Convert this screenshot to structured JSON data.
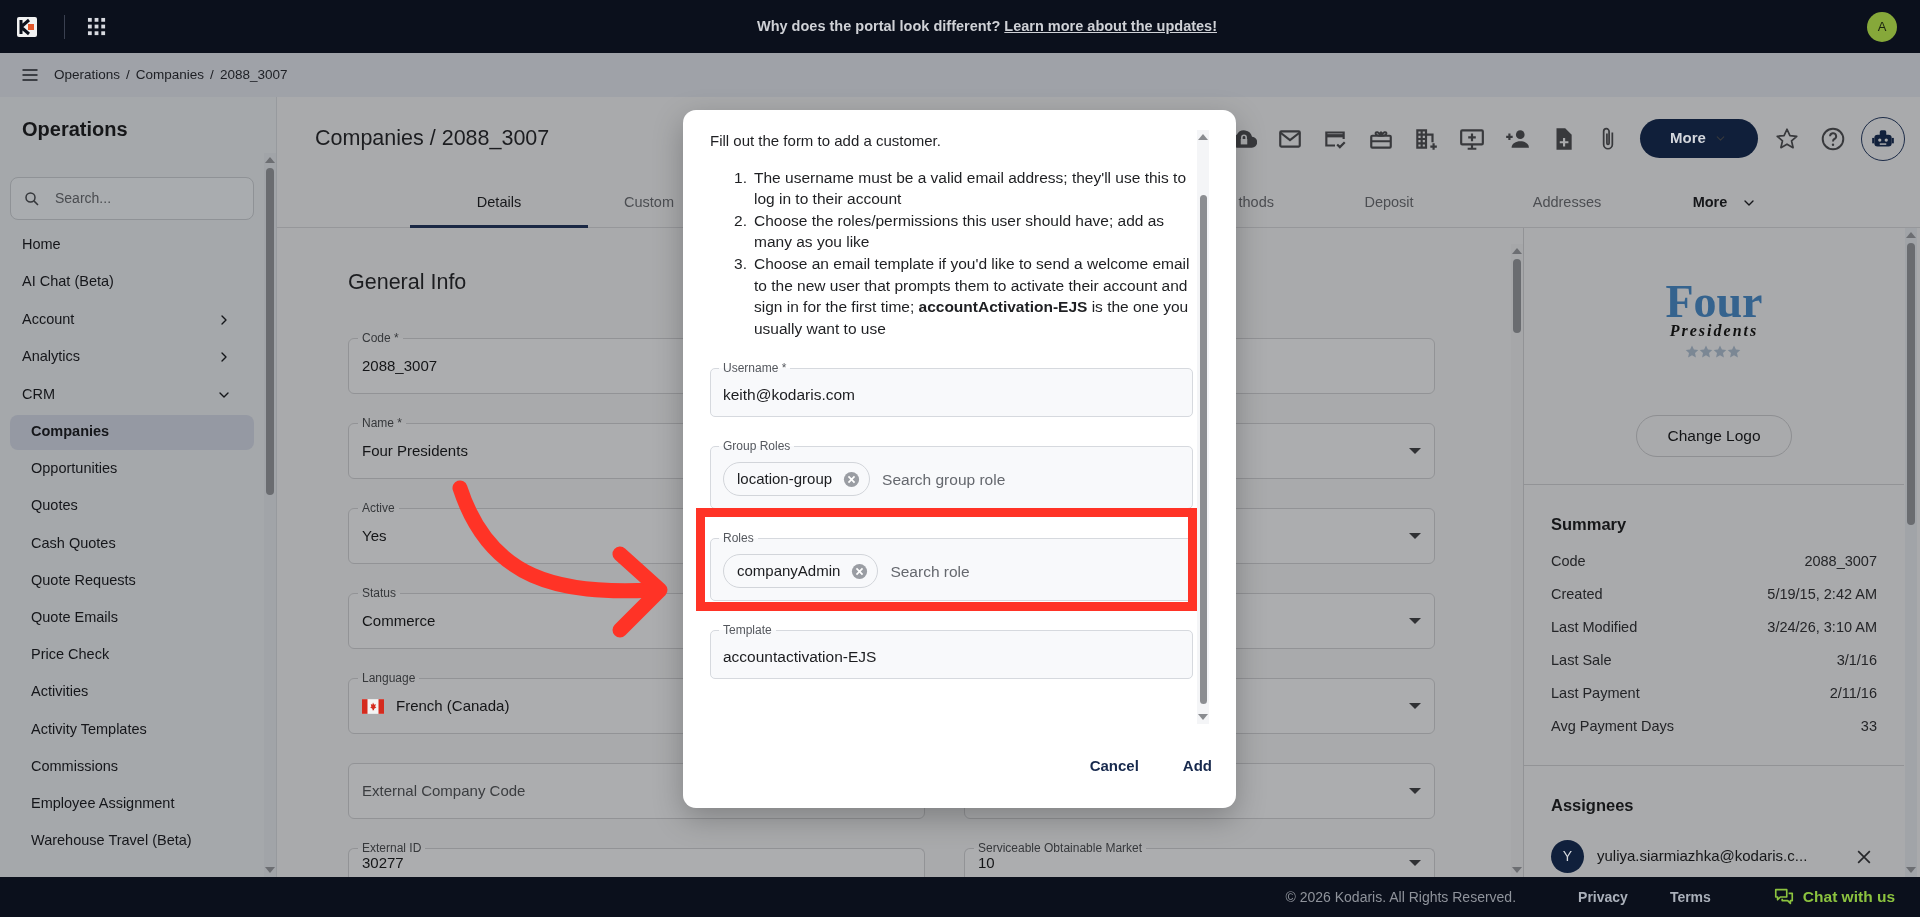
{
  "top_bar": {
    "announcement": "Why does the portal look different?",
    "link": "Learn more about the updates!",
    "avatar": "A"
  },
  "breadcrumb": {
    "separator": "/",
    "items": [
      "Operations",
      "Companies",
      "2088_3007"
    ]
  },
  "sidebar": {
    "title": "Operations",
    "search": {
      "placeholder": "Search..."
    },
    "items": [
      {
        "kind": "link",
        "label": "Home",
        "selected": false
      },
      {
        "kind": "link",
        "label": "AI Chat (Beta)",
        "selected": false
      },
      {
        "kind": "group",
        "label": "Account",
        "expanded": false,
        "selected": false
      },
      {
        "kind": "group",
        "label": "Analytics",
        "expanded": false,
        "selected": false
      },
      {
        "kind": "group",
        "label": "CRM",
        "expanded": true,
        "selected": false,
        "children": [
          {
            "label": "Companies",
            "selected": true
          },
          {
            "label": "Opportunities",
            "selected": false
          },
          {
            "label": "Quotes",
            "selected": false
          },
          {
            "label": "Cash Quotes",
            "selected": false
          },
          {
            "label": "Quote Requests",
            "selected": false
          },
          {
            "label": "Quote Emails",
            "selected": false
          },
          {
            "label": "Price Check",
            "selected": false
          },
          {
            "label": "Activities",
            "selected": false
          },
          {
            "label": "Activity Templates",
            "selected": false
          },
          {
            "label": "Commissions",
            "selected": false
          },
          {
            "label": "Employee Assignment",
            "selected": false
          },
          {
            "label": "Warehouse Travel (Beta)",
            "selected": false
          }
        ]
      }
    ]
  },
  "page": {
    "title": "Companies / 2088_3007",
    "more_button": "More",
    "tabs": [
      {
        "label": "Details",
        "selected": true
      },
      {
        "label": "Custom",
        "selected": false
      },
      {
        "label": "thods",
        "selected": false
      },
      {
        "label": "Deposit",
        "selected": false
      },
      {
        "label": "Addresses",
        "selected": false
      },
      {
        "label": "More",
        "selected": false,
        "kind": "menu"
      }
    ],
    "section_title": "General Info",
    "field_rows": [
      {
        "left": {
          "kind": "text",
          "label": "Code *",
          "value": "2088_3007"
        },
        "right": {
          "kind": "text"
        }
      },
      {
        "left": {
          "kind": "text",
          "label": "Name *",
          "value": "Four Presidents"
        },
        "right": {
          "kind": "select"
        }
      },
      {
        "left": {
          "kind": "text",
          "label": "Active",
          "value": "Yes"
        },
        "right": {
          "kind": "select"
        }
      },
      {
        "left": {
          "kind": "text",
          "label": "Status",
          "value": "Commerce"
        },
        "right": {
          "kind": "select"
        }
      },
      {
        "left": {
          "kind": "language",
          "label": "Language",
          "value": "French (Canada)"
        },
        "right": {
          "kind": "select"
        }
      },
      {
        "left": {
          "kind": "text",
          "placeholder": "External Company Code"
        },
        "right": {
          "kind": "select"
        }
      },
      {
        "left": {
          "kind": "text",
          "label": "External ID",
          "value": "30277"
        },
        "right": {
          "kind": "select",
          "label": "Serviceable Obtainable Market",
          "value": "10"
        }
      }
    ]
  },
  "summary_panel": {
    "logo": {
      "name": "Four",
      "tagline": "Presidents"
    },
    "change_logo": "Change Logo",
    "summary": {
      "title": "Summary",
      "rows": [
        {
          "label": "Code",
          "value": "2088_3007"
        },
        {
          "label": "Created",
          "value": "5/19/15, 2:42 AM"
        },
        {
          "label": "Last Modified",
          "value": "3/24/26, 3:10 AM"
        },
        {
          "label": "Last Sale",
          "value": "3/1/16"
        },
        {
          "label": "Last Payment",
          "value": "2/11/16"
        },
        {
          "label": "Avg Payment Days",
          "value": "33"
        }
      ]
    },
    "assignees": {
      "title": "Assignees",
      "items": [
        {
          "initial": "Y",
          "email": "yuliya.siarmiazhka@kodaris.c..."
        }
      ]
    }
  },
  "footer": {
    "copyright": "© 2026 Kodaris. All Rights Reserved.",
    "links": [
      "Privacy",
      "Terms"
    ],
    "chat": "Chat with us"
  },
  "dialog": {
    "intro": "Fill out the form to add a customer.",
    "steps": [
      {
        "number": "1.",
        "text": "The username must be a valid email address; they'll use this to log in to their account"
      },
      {
        "number": "2.",
        "text": "Choose the roles/permissions this user should have; add as many as you like"
      },
      {
        "number": "3.",
        "text": "Choose an email template if you'd like to send a welcome email to the new user that prompts them to activate their account and sign in for the first time; **accountActivation-EJS** is the one you usually want to use"
      }
    ],
    "fields": [
      {
        "kind": "text",
        "label": "Username *",
        "value": "keith@kodaris.com",
        "highlighted": false
      },
      {
        "kind": "chips",
        "label": "Group Roles",
        "chips": [
          "location-group"
        ],
        "placeholder": "Search group role",
        "highlighted": false
      },
      {
        "kind": "chips",
        "label": "Roles",
        "chips": [
          "companyAdmin"
        ],
        "placeholder": "Search role",
        "highlighted": true
      },
      {
        "kind": "text",
        "label": "Template",
        "value": "accountactivation-EJS",
        "highlighted": false
      }
    ],
    "buttons": [
      "Cancel",
      "Add"
    ]
  }
}
